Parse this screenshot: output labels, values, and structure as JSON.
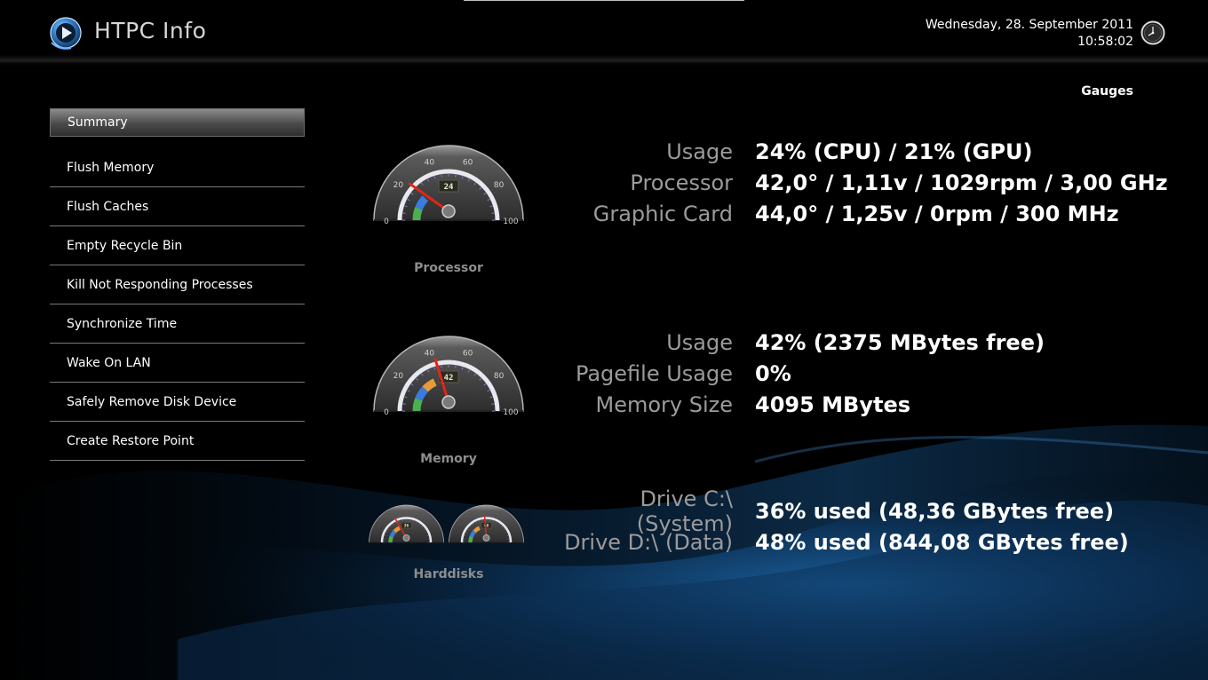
{
  "header": {
    "app_title": "HTPC Info",
    "date": "Wednesday, 28. September 2011",
    "time": "10:58:02",
    "section_label": "Gauges"
  },
  "menu": {
    "items": [
      {
        "label": "Summary",
        "active": true
      },
      {
        "label": "Flush Memory"
      },
      {
        "label": "Flush Caches"
      },
      {
        "label": "Empty Recycle Bin"
      },
      {
        "label": "Kill Not Responding Processes"
      },
      {
        "label": "Synchronize Time"
      },
      {
        "label": "Wake On LAN"
      },
      {
        "label": "Safely Remove Disk Device"
      },
      {
        "label": "Create Restore Point"
      }
    ]
  },
  "gauges": {
    "processor": {
      "caption": "Processor",
      "value": 24,
      "ticks": [
        "0",
        "20",
        "40",
        "60",
        "80",
        "100"
      ]
    },
    "memory": {
      "caption": "Memory",
      "value": 42,
      "ticks": [
        "0",
        "20",
        "40",
        "60",
        "80",
        "100"
      ]
    },
    "harddisks": {
      "caption": "Harddisks",
      "drive_c_value": 36,
      "drive_d_value": 48
    }
  },
  "stats": {
    "processor": [
      {
        "label": "Usage",
        "value": "24% (CPU) / 21% (GPU)"
      },
      {
        "label": "Processor",
        "value": "42,0° / 1,11v / 1029rpm / 3,00 GHz"
      },
      {
        "label": "Graphic Card",
        "value": "44,0° / 1,25v / 0rpm / 300 MHz"
      }
    ],
    "memory": [
      {
        "label": "Usage",
        "value": "42% (2375 MBytes free)"
      },
      {
        "label": "Pagefile Usage",
        "value": "0%"
      },
      {
        "label": "Memory Size",
        "value": "4095 MBytes"
      }
    ],
    "disks": [
      {
        "label": "Drive C:\\ (System)",
        "value": "36% used (48,36 GBytes free)"
      },
      {
        "label": "Drive D:\\ (Data)",
        "value": "48% used (844,08 GBytes free)"
      }
    ]
  },
  "colors": {
    "background": "#000000",
    "accent_blue": "#1a5d9e",
    "needle": "#e0261a",
    "label_gray": "#9b9b9b"
  }
}
